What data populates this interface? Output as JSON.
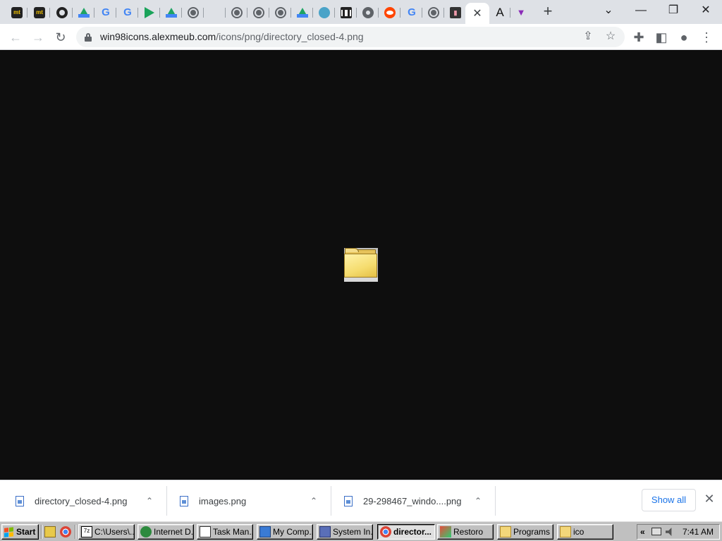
{
  "browser": {
    "pinned_tab_icons": [
      "mt-icon",
      "mt-icon",
      "github-icon",
      "google-drive-icon",
      "google-icon",
      "google-icon",
      "play-icon",
      "google-drive-icon",
      "globe-icon",
      "microsoft-icon",
      "globe-icon",
      "globe-icon",
      "globe-icon",
      "google-drive-icon",
      "world-icon",
      "museum-icon",
      "chrome-icon",
      "reddit-icon",
      "google-icon",
      "globe-icon",
      "film-icon"
    ],
    "active_tab_close_glyph": "✕",
    "after_tabs": [
      {
        "icon": "letter-a-icon",
        "glyph": "A"
      },
      {
        "icon": "v-logo-icon",
        "glyph": "▼"
      }
    ],
    "new_tab_glyph": "+",
    "window_controls": {
      "tab_search": "⌄",
      "minimize": "—",
      "restore": "❐",
      "close": "✕"
    }
  },
  "toolbar": {
    "back_glyph": "←",
    "forward_glyph": "→",
    "reload_glyph": "↻",
    "url_domain": "win98icons.alexmeub.com",
    "url_path": "/icons/png/directory_closed-4.png",
    "share_glyph": "⇪",
    "bookmark_glyph": "☆",
    "extensions_glyph": "✚",
    "sidepanel_glyph": "◧",
    "profile_glyph": "●",
    "menu_glyph": "⋮"
  },
  "downloads": {
    "items": [
      {
        "name": "directory_closed-4.png"
      },
      {
        "name": "images.png"
      },
      {
        "name": "29-298467_windo....png"
      }
    ],
    "chevron_glyph": "⌃",
    "show_all_label": "Show all",
    "close_glyph": "✕"
  },
  "taskbar": {
    "start_label": "Start",
    "buttons": [
      {
        "label": "C:\\Users\\...",
        "icon": "terminal-icon"
      },
      {
        "label": "Internet D...",
        "icon": "internet-download-icon"
      },
      {
        "label": "Task Man...",
        "icon": "task-manager-icon"
      },
      {
        "label": "My Comp...",
        "icon": "my-computer-icon"
      },
      {
        "label": "System In...",
        "icon": "system-info-icon"
      },
      {
        "label": "director...",
        "icon": "chrome-icon",
        "active": true
      },
      {
        "label": "Restoro",
        "icon": "restoro-icon"
      },
      {
        "label": "Programs",
        "icon": "folder-icon"
      },
      {
        "label": "ico",
        "icon": "folder-icon"
      }
    ],
    "tray": {
      "expand_glyph": "«",
      "clock": "7:41 AM"
    }
  },
  "colors": {
    "content_background": "#0e0e0e",
    "tab_strip": "#dee1e6",
    "link_blue": "#1a73e8",
    "taskbar_gray": "#c0c0c0"
  }
}
